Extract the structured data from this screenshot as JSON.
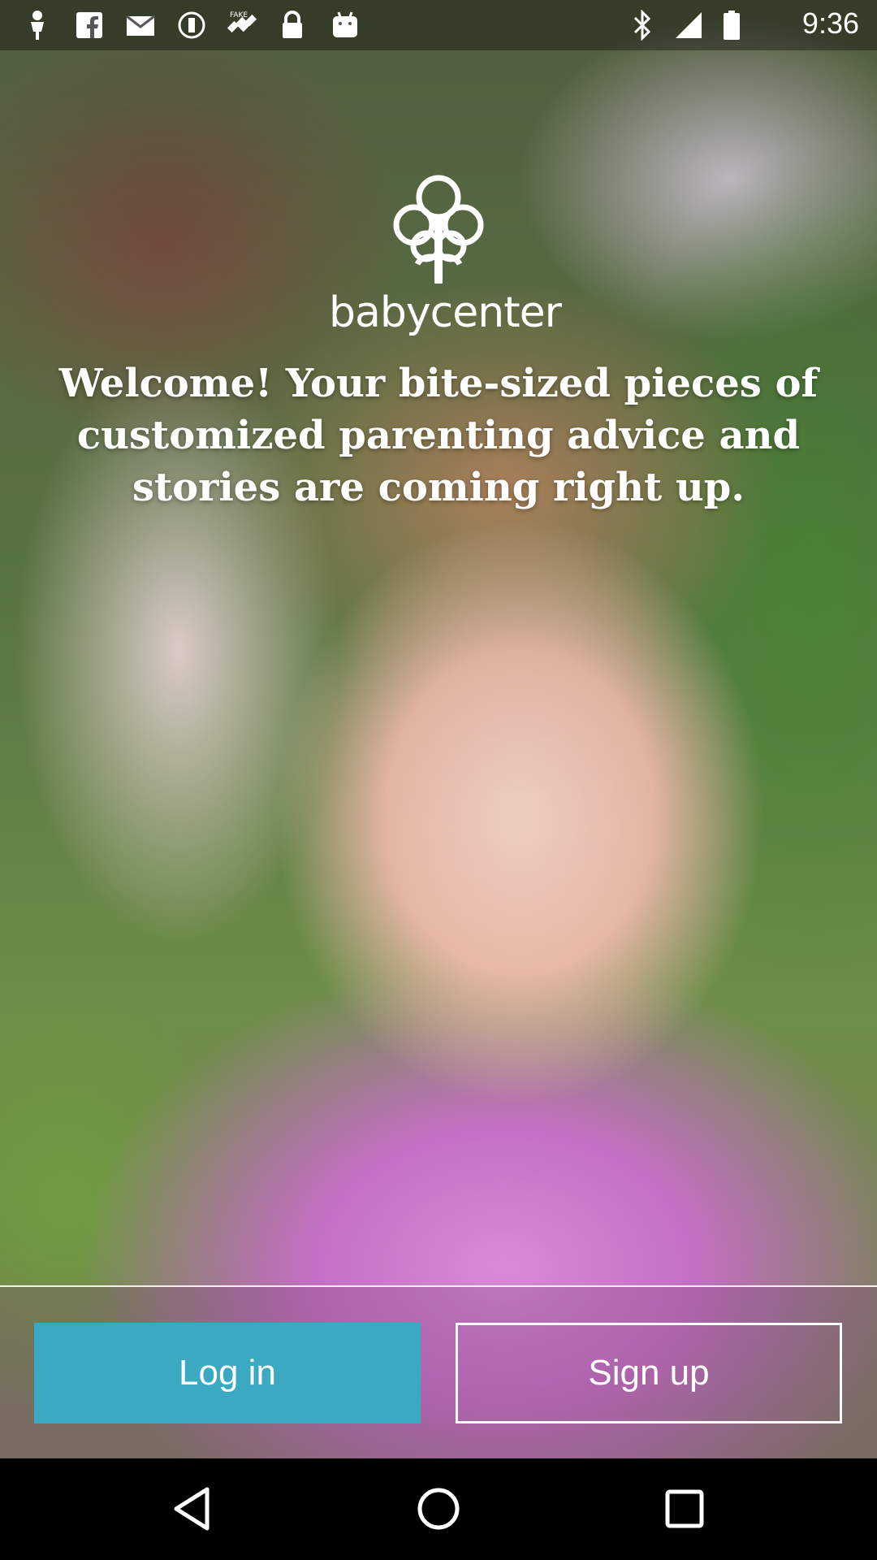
{
  "status_bar": {
    "time": "9:36",
    "left_icons": [
      "person-icon",
      "facebook-icon",
      "mail-icon",
      "alert-icon",
      "satellite-icon",
      "lock-icon",
      "android-icon"
    ],
    "right_icons": [
      "bluetooth-icon",
      "signal-icon",
      "battery-icon"
    ]
  },
  "logo": {
    "text": "babycenter",
    "trademark": "™"
  },
  "welcome": {
    "line1": "Welcome! Your bite-sized pieces of",
    "line2": "customized parenting advice and",
    "line3": "stories are coming right up."
  },
  "actions": {
    "login_label": "Log in",
    "signup_label": "Sign up"
  },
  "colors": {
    "login_button": "#3aa9c1",
    "text": "#ffffff"
  },
  "nav_bar": {
    "icons": [
      "back-icon",
      "home-icon",
      "recents-icon"
    ]
  }
}
